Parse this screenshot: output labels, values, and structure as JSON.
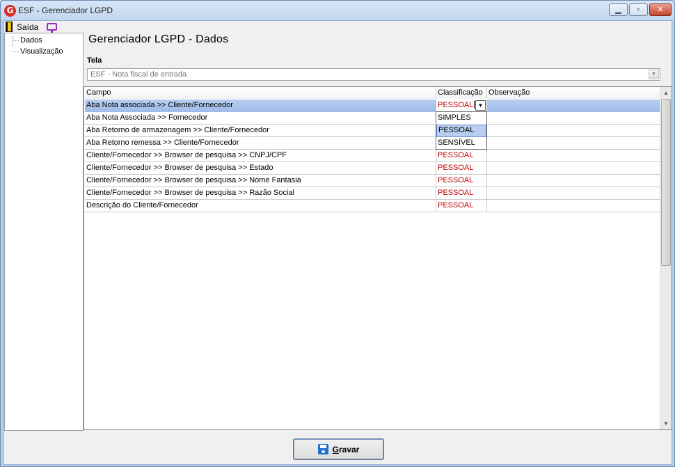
{
  "window": {
    "app_icon_letter": "G",
    "title": "ESF - Gerenciador LGPD",
    "minimize_glyph": "▁",
    "maximize_glyph": "▫",
    "close_glyph": "✕"
  },
  "menu": {
    "exit_label": "Saída"
  },
  "tree": {
    "items": [
      {
        "label": "Dados"
      },
      {
        "label": "Visualização"
      }
    ]
  },
  "page": {
    "title": "Gerenciador LGPD - Dados",
    "tela_label": "Tela",
    "tela_value": "ESF - Nota fiscal de entrada"
  },
  "grid": {
    "columns": [
      "Campo",
      "Classificação",
      "Observação"
    ],
    "rows": [
      {
        "campo": "Aba Nota associada >> Cliente/Fornecedor",
        "classificacao": "PESSOAL",
        "observacao": ""
      },
      {
        "campo": "Aba Nota Associada >> Fornecedor",
        "classificacao": "",
        "observacao": ""
      },
      {
        "campo": "Aba Retorno de armazenagem >>  Cliente/Fornecedor",
        "classificacao": "",
        "observacao": ""
      },
      {
        "campo": "Aba Retorno remessa >> Cliente/Fornecedor",
        "classificacao": "",
        "observacao": ""
      },
      {
        "campo": "Cliente/Fornecedor >> Browser de pesquisa >> CNPJ/CPF",
        "classificacao": "PESSOAL",
        "observacao": ""
      },
      {
        "campo": "Cliente/Fornecedor >> Browser de pesquisa >> Estado",
        "classificacao": "PESSOAL",
        "observacao": ""
      },
      {
        "campo": "Cliente/Fornecedor >> Browser de pesquisa >> Nome Fantasia",
        "classificacao": "PESSOAL",
        "observacao": ""
      },
      {
        "campo": "Cliente/Fornecedor >> Browser de pesquisa >> Razão Social",
        "classificacao": "PESSOAL",
        "observacao": ""
      },
      {
        "campo": "Descrição do Cliente/Fornecedor",
        "classificacao": "PESSOAL",
        "observacao": ""
      }
    ],
    "dropdown_options": [
      "SIMPLES",
      "PESSOAL",
      "SENSÍVEL"
    ],
    "dropdown_highlighted": "PESSOAL"
  },
  "actions": {
    "save_label_first": "G",
    "save_label_rest": "ravar"
  },
  "colors": {
    "classification_text": "#c00000",
    "selected_row": "#b8cef0",
    "save_icon": "#1f6ed4",
    "app_icon": "#d92a2a"
  }
}
